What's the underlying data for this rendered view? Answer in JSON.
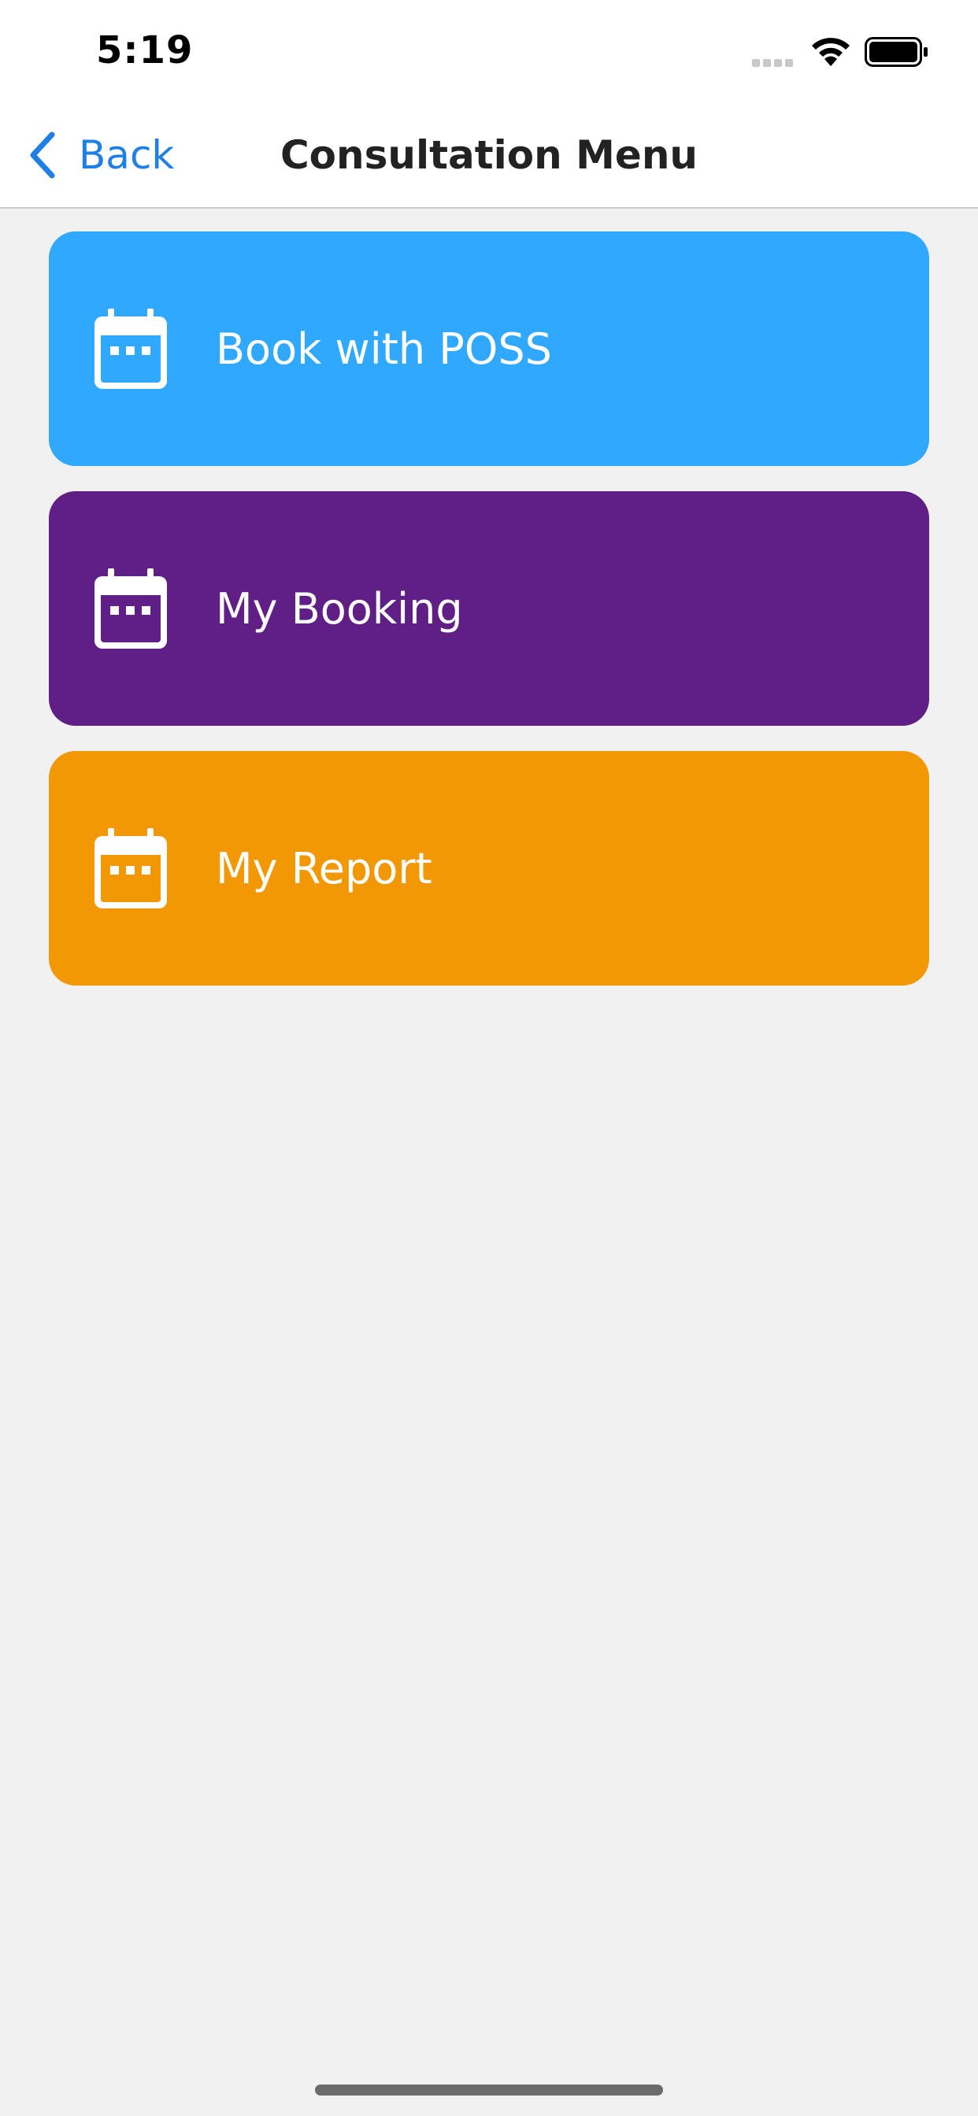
{
  "status_bar": {
    "time": "5:19",
    "icons": [
      "cellular-signal-icon",
      "wifi-icon",
      "battery-icon"
    ]
  },
  "nav": {
    "back_label": "Back",
    "title": "Consultation Menu",
    "accent_color": "#1f7fe6"
  },
  "menu": {
    "items": [
      {
        "label": "Book with POSS",
        "icon": "calendar-icon",
        "color": "#2fa8fd"
      },
      {
        "label": "My Booking",
        "icon": "calendar-icon",
        "color": "#5f1f84"
      },
      {
        "label": "My Report",
        "icon": "calendar-icon",
        "color": "#f29805"
      }
    ]
  }
}
